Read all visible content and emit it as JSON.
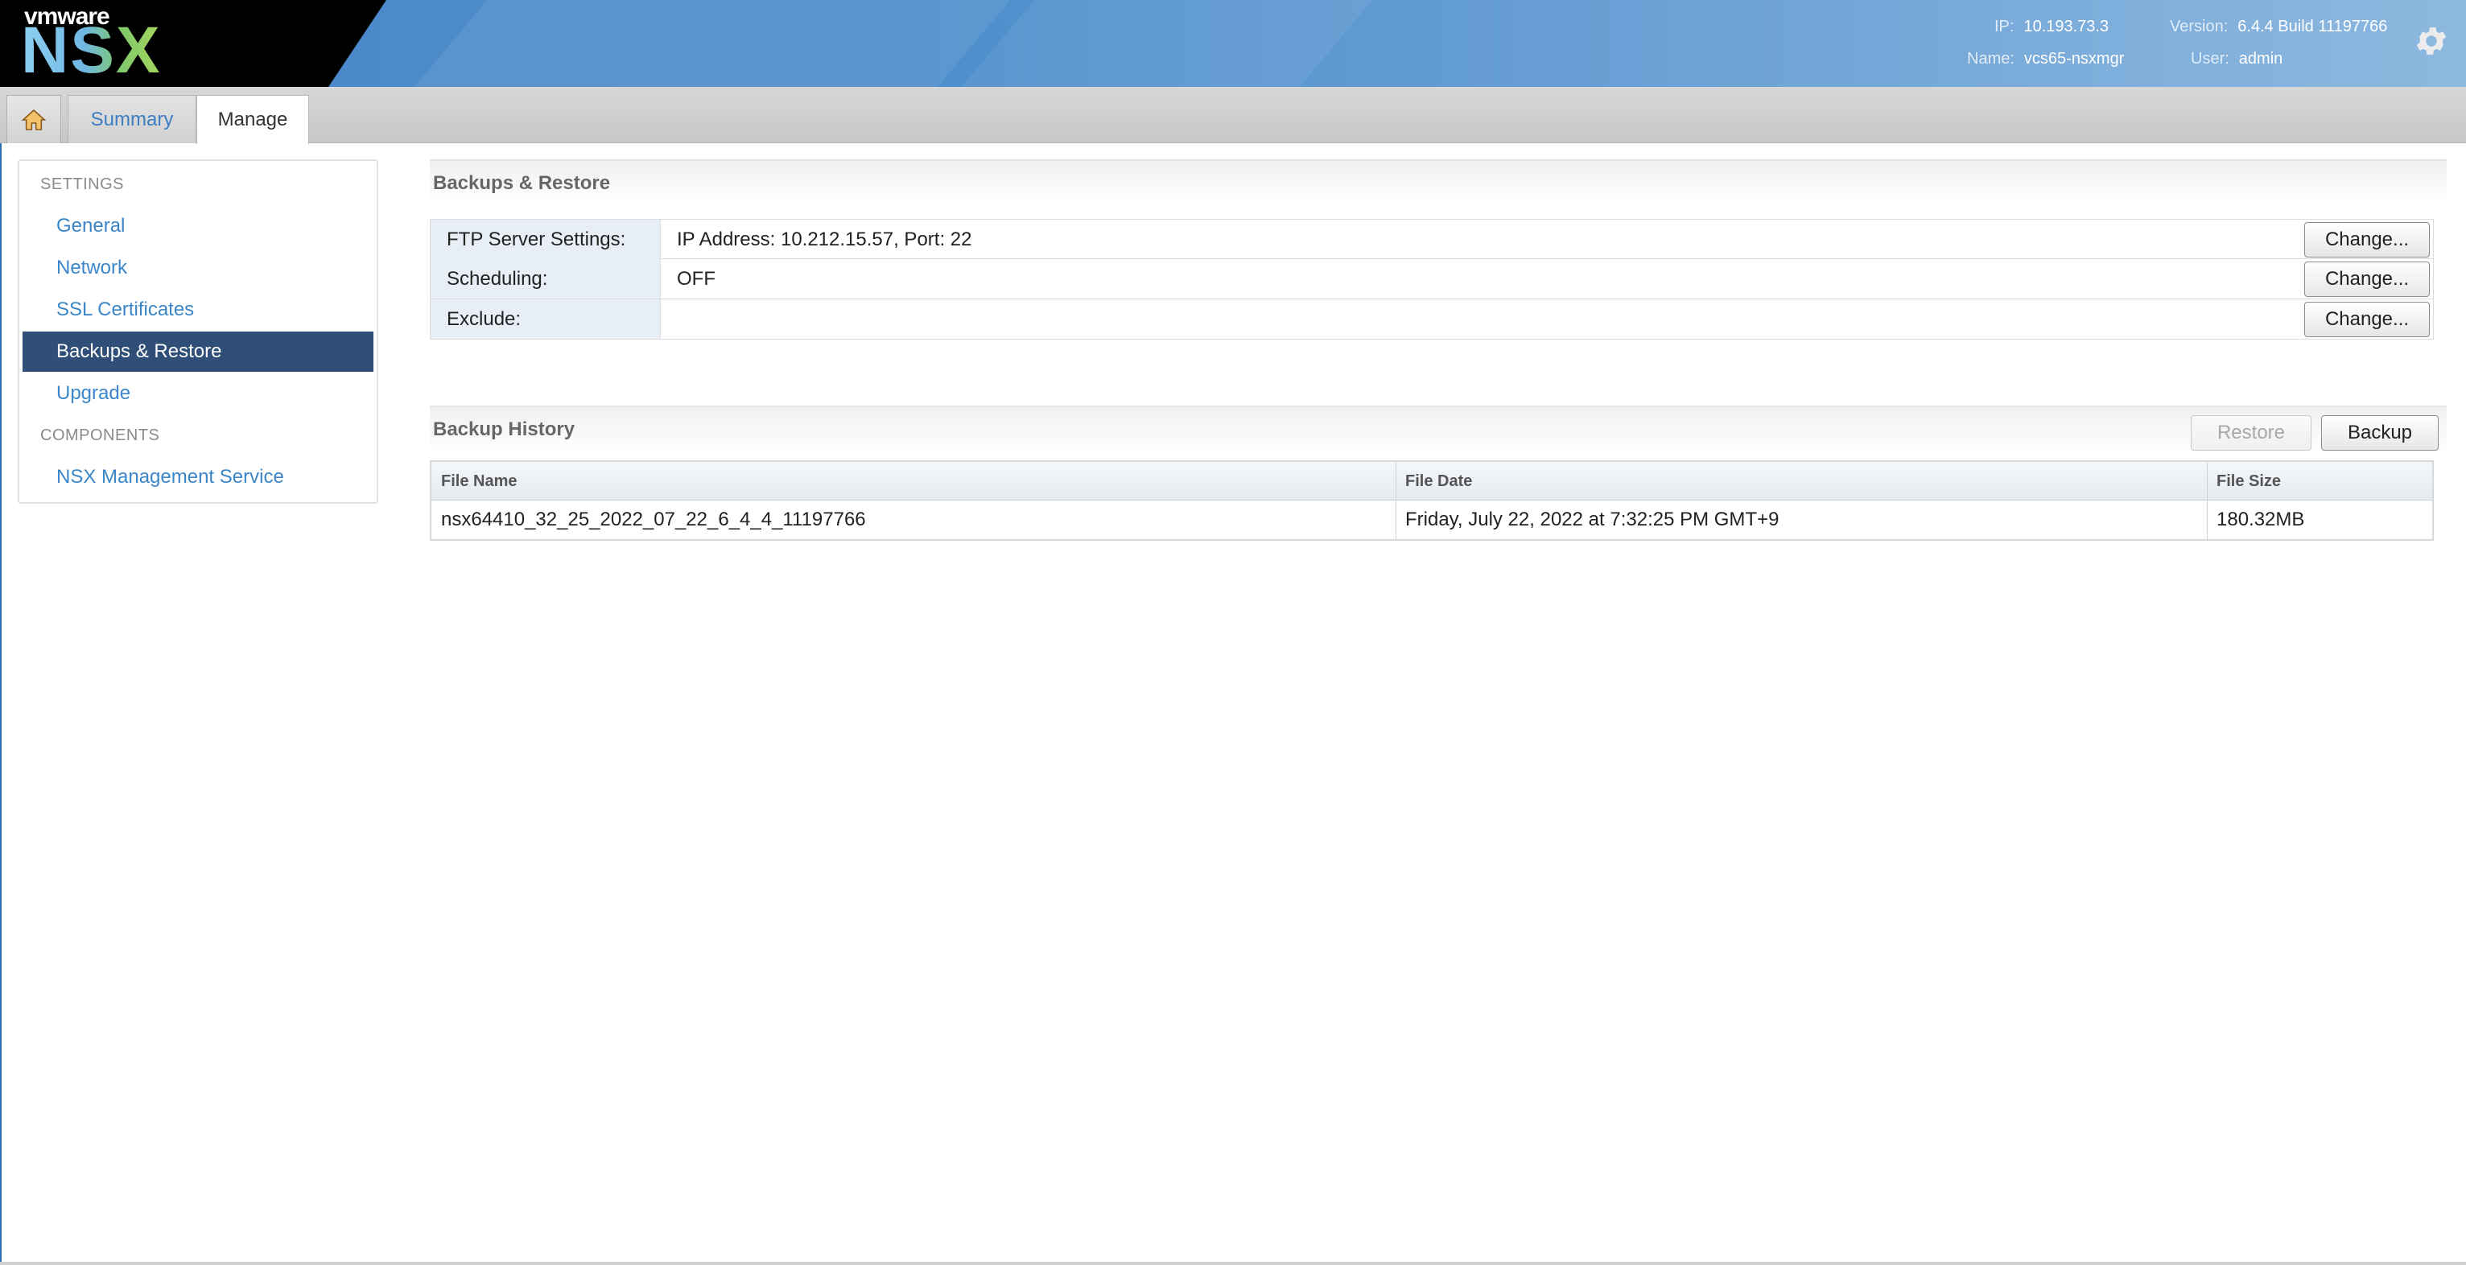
{
  "brand": {
    "vmware": "vmware",
    "product": "NSX"
  },
  "header": {
    "ip_label": "IP:",
    "ip": "10.193.73.3",
    "name_label": "Name:",
    "name": "vcs65-nsxmgr",
    "version_label": "Version:",
    "version": "6.4.4 Build 11197766",
    "user_label": "User:",
    "user": "admin",
    "settings_icon": "gear-icon"
  },
  "tabs": {
    "home_icon": "home-icon",
    "summary": "Summary",
    "manage": "Manage"
  },
  "sidebar": {
    "settings_section": "SETTINGS",
    "components_section": "COMPONENTS",
    "items": [
      {
        "label": "General"
      },
      {
        "label": "Network"
      },
      {
        "label": "SSL Certificates"
      },
      {
        "label": "Backups & Restore",
        "active": true
      },
      {
        "label": "Upgrade"
      }
    ],
    "components": [
      {
        "label": "NSX Management Service"
      }
    ]
  },
  "backups_restore": {
    "title": "Backups & Restore",
    "rows": [
      {
        "label": "FTP Server Settings:",
        "value": "IP Address: 10.212.15.57, Port: 22",
        "button": "Change..."
      },
      {
        "label": "Scheduling:",
        "value": "OFF",
        "button": "Change..."
      },
      {
        "label": "Exclude:",
        "value": "",
        "button": "Change..."
      }
    ]
  },
  "backup_history": {
    "title": "Backup History",
    "restore_button": "Restore",
    "backup_button": "Backup",
    "columns": [
      "File Name",
      "File Date",
      "File Size"
    ],
    "rows": [
      [
        "nsx64410_32_25_2022_07_22_6_4_4_11197766",
        "Friday, July 22, 2022 at 7:32:25 PM GMT+9",
        "180.32MB"
      ]
    ]
  },
  "colors": {
    "header_blue": "#4a86c7",
    "sidebar_active": "#2f4f78",
    "link_blue": "#3b86c8"
  }
}
